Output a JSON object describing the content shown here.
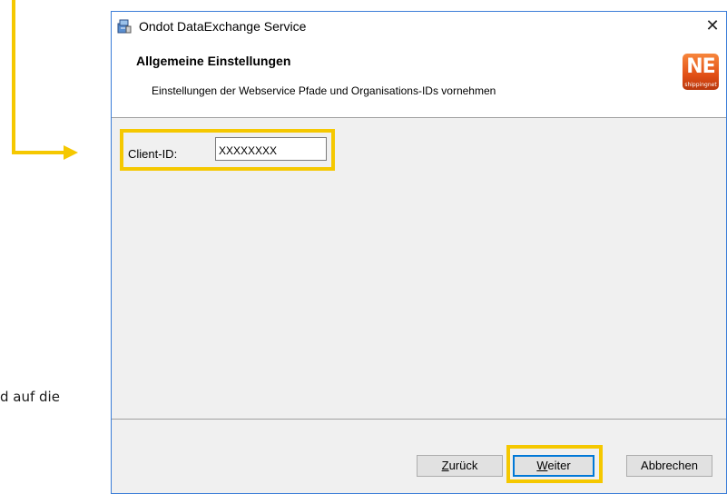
{
  "background_text": "d auf die",
  "dialog": {
    "title": "Ondot DataExchange Service",
    "close_glyph": "✕",
    "banner": {
      "title": "Allgemeine Einstellungen",
      "subtitle": "Einstellungen der Webservice Pfade und Organisations-IDs vornehmen",
      "logo_text": "NE",
      "logo_subtext": "shippingnet"
    },
    "form": {
      "client_id_label": "Client-ID:",
      "client_id_value": "XXXXXXXX"
    },
    "buttons": {
      "back_mnemonic": "Z",
      "back_rest": "urück",
      "next_mnemonic": "W",
      "next_rest": "eiter",
      "cancel": "Abbrechen"
    }
  },
  "icons": {
    "app_icon": "installer-icon",
    "close": "close-icon",
    "logo": "shippingnet-logo-icon"
  },
  "colors": {
    "highlight": "#f5c800",
    "dialog_border": "#3b7dd8",
    "default_button_border": "#0078d7",
    "logo_orange": "#e14f16"
  }
}
